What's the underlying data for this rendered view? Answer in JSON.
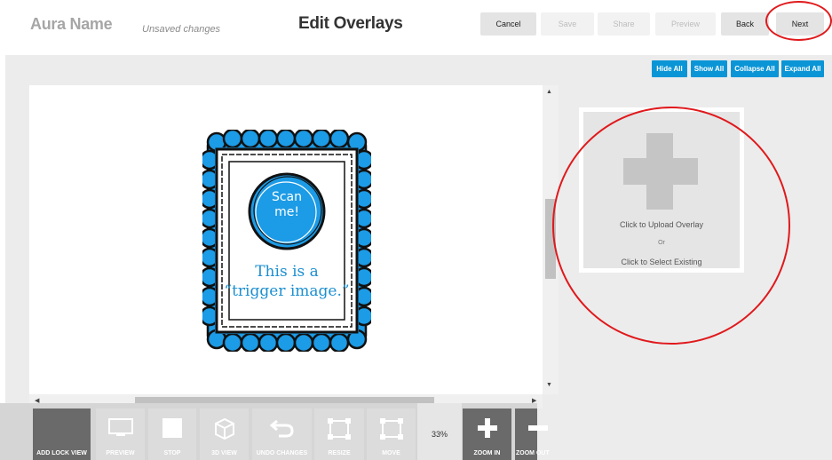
{
  "header": {
    "app_title": "Aura Name",
    "status": "Unsaved changes",
    "page_title": "Edit Overlays",
    "buttons": {
      "cancel": "Cancel",
      "save": "Save",
      "share": "Share",
      "preview": "Preview",
      "back": "Back",
      "next": "Next"
    }
  },
  "panel_controls": {
    "hide_all": "Hide All",
    "show_all": "Show All",
    "collapse_all": "Collapse All",
    "expand_all": "Expand All"
  },
  "trigger_image": {
    "badge": "Scan me!",
    "badge_line1": "Scan",
    "badge_line2": "me!",
    "caption_line1": "This is a",
    "caption_line2": "“trigger image.”"
  },
  "upload_box": {
    "upload_label": "Click to Upload Overlay",
    "or_label": "Or",
    "select_label": "Click to Select Existing"
  },
  "toolbar": {
    "items": [
      {
        "label": "ADD LOCK VIEW",
        "icon": "lock-view-icon"
      },
      {
        "label": "PREVIEW",
        "icon": "monitor-icon"
      },
      {
        "label": "STOP",
        "icon": "stop-icon"
      },
      {
        "label": "3D VIEW",
        "icon": "cube-icon"
      },
      {
        "label": "UNDO CHANGES",
        "icon": "undo-icon"
      },
      {
        "label": "RESIZE",
        "icon": "resize-icon"
      },
      {
        "label": "MOVE",
        "icon": "move-icon"
      },
      {
        "label": "ZOOM IN",
        "icon": "plus-icon"
      },
      {
        "label": "ZOOM OUT",
        "icon": "minus-icon"
      }
    ],
    "zoom_value": "33%"
  },
  "colors": {
    "accent": "#0a95d6",
    "callout": "#e0191c",
    "trigger_blue": "#1c8fd1"
  }
}
